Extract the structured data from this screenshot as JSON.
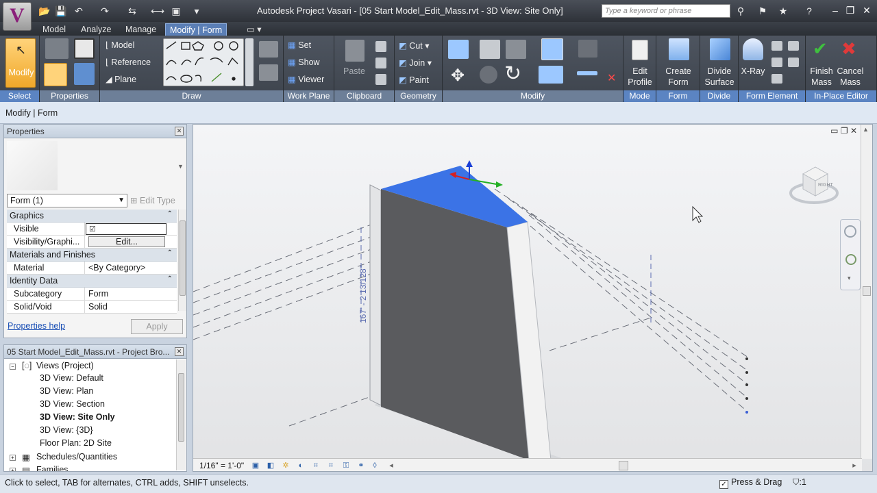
{
  "app": {
    "logo_letter": "V",
    "title": "Autodesk Project Vasari - [05 Start Model_Edit_Mass.rvt - 3D View: Site Only]",
    "search_placeholder": "Type a keyword or phrase"
  },
  "tabs": [
    "Model",
    "Analyze",
    "Manage",
    "Modify | Form"
  ],
  "ribbon": {
    "select": {
      "modify": "Modify",
      "label": "Select"
    },
    "properties": {
      "label": "Properties"
    },
    "model_items": [
      "Model",
      "Reference",
      "Plane"
    ],
    "draw": {
      "label": "Draw"
    },
    "work_plane": {
      "items": [
        "Set",
        "Show",
        "Viewer"
      ],
      "label": "Work Plane"
    },
    "clipboard": {
      "paste": "Paste",
      "label": "Clipboard"
    },
    "geometry": {
      "items": [
        "Cut",
        "Join",
        "Paint"
      ],
      "label": "Geometry"
    },
    "modify": {
      "label": "Modify"
    },
    "mode": {
      "button": [
        "Edit",
        "Profile"
      ],
      "label": "Mode"
    },
    "form": {
      "button": [
        "Create",
        "Form"
      ],
      "label": "Form"
    },
    "divide": {
      "button": [
        "Divide",
        "Surface"
      ],
      "label": "Divide"
    },
    "form_element": {
      "button": "X-Ray",
      "label": "Form Element"
    },
    "in_place": {
      "finish": [
        "Finish",
        "Mass"
      ],
      "cancel": [
        "Cancel",
        "Mass"
      ],
      "label": "In-Place Editor"
    }
  },
  "options_bar": {
    "text": "Modify | Form"
  },
  "properties": {
    "title": "Properties",
    "instance": "Form (1)",
    "edit_type": "Edit Type",
    "groups": [
      {
        "name": "Graphics",
        "rows": [
          {
            "name": "Visible",
            "value": "☑"
          },
          {
            "name": "Visibility/Graphi...",
            "value": "Edit..."
          }
        ]
      },
      {
        "name": "Materials and Finishes",
        "rows": [
          {
            "name": "Material",
            "value": "<By Category>"
          }
        ]
      },
      {
        "name": "Identity Data",
        "rows": [
          {
            "name": "Subcategory",
            "value": "Form"
          },
          {
            "name": "Solid/Void",
            "value": "Solid"
          }
        ]
      }
    ],
    "help_link": "Properties help",
    "apply": "Apply"
  },
  "browser": {
    "title": "05 Start Model_Edit_Mass.rvt - Project Bro...",
    "root": "Views (Project)",
    "views": [
      "3D View: Default",
      "3D View: Plan",
      "3D View: Section",
      "3D View: Site Only",
      "3D View: {3D}",
      "Floor Plan: 2D Site"
    ],
    "active_view": "3D View: Site Only",
    "schedules": "Schedules/Quantities",
    "families": "Families"
  },
  "viewport": {
    "dimension": "167' - 2 13/128\"",
    "scale": "1/16\" = 1'-0\"",
    "viewcube_face": "RIGHT"
  },
  "status": {
    "text": "Click to select, TAB for alternates, CTRL adds, SHIFT unselects.",
    "press_drag": "Press & Drag",
    "filter_count": ":1"
  },
  "colors": {
    "selected_face": "#3b73e6",
    "active_tab": "#5b7fb6",
    "panel_label": "#6d7f98",
    "finish_check": "#3fbf3f",
    "cancel_x": "#e03a3a"
  }
}
